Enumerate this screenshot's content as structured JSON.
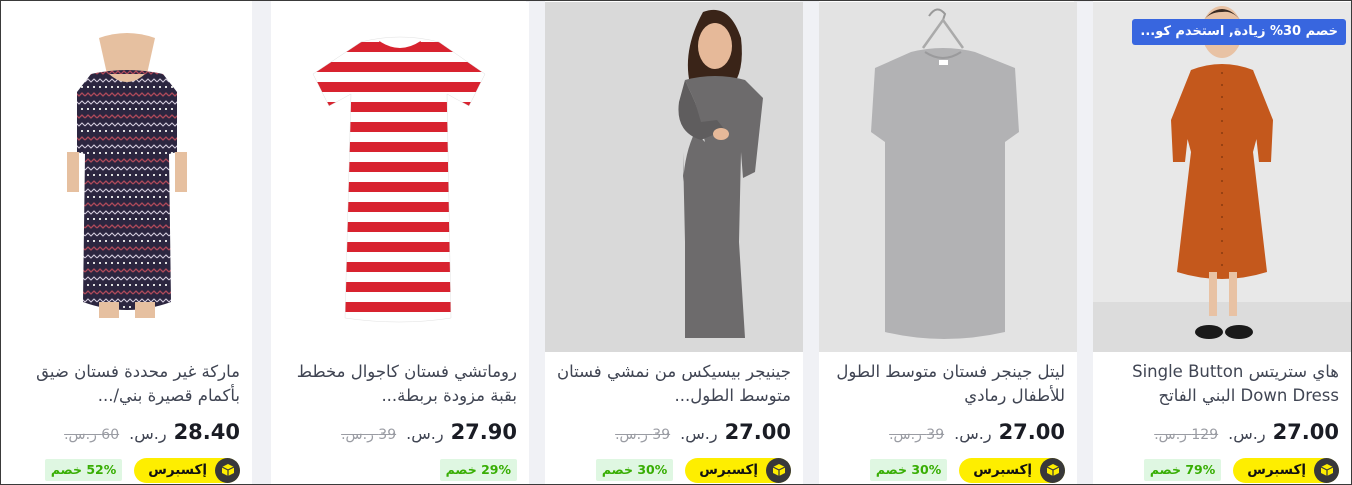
{
  "products": [
    {
      "title": "هاي ستريتس Single Button Down Dress البني الفاتح",
      "price": "27.00",
      "currency": "ر.س.",
      "old_price": "129 ر.س.",
      "discount": "79% خصم",
      "express": "إكسبرس",
      "promo": "خصم 30% زيادة, استخدم كو..."
    },
    {
      "title": "ليتل جينجر فستان متوسط الطول للأطفال رمادي",
      "price": "27.00",
      "currency": "ر.س.",
      "old_price": "39 ر.س.",
      "discount": "30% خصم",
      "express": "إكسبرس"
    },
    {
      "title": "جينيجر بيسيكس من نمشي فستان متوسط الطول...",
      "price": "27.00",
      "currency": "ر.س.",
      "old_price": "39 ر.س.",
      "discount": "30% خصم",
      "express": "إكسبرس"
    },
    {
      "title": "روماتشي فستان كاجوال مخطط بقبة مزودة بربطة...",
      "price": "27.90",
      "currency": "ر.س.",
      "old_price": "39 ر.س.",
      "discount": "29% خصم"
    },
    {
      "title": "ماركة غير محددة فستان ضيق بأكمام قصيرة بني/...",
      "price": "28.40",
      "currency": "ر.س.",
      "old_price": "60 ر.س.",
      "discount": "52% خصم",
      "express": "إكسبرس"
    }
  ],
  "colors": {
    "express_yellow": "#feee00",
    "discount_green": "#38ae04",
    "discount_bg": "#dff7e2",
    "promo_blue": "#3866df"
  }
}
